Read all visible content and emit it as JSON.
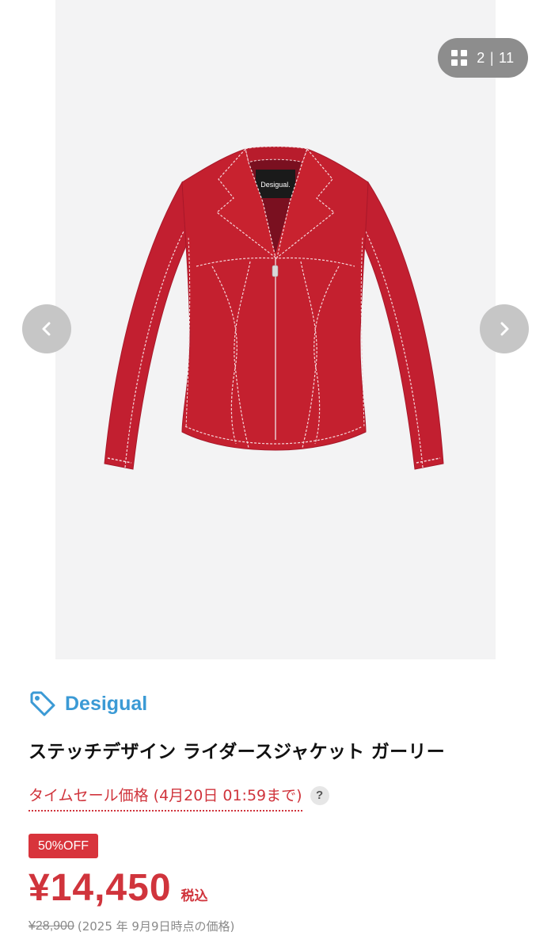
{
  "gallery": {
    "counter": {
      "current": "2",
      "separator": "|",
      "total": "11"
    },
    "jacket_label": "Desigual.",
    "prev_icon": "chevron-left-icon",
    "next_icon": "chevron-right-icon",
    "grid_icon": "grid-icon"
  },
  "product": {
    "brand": "Desigual",
    "brand_icon": "tag-icon",
    "title": "ステッチデザイン ライダースジャケット ガーリー",
    "sale_label": "タイムセール価格 (4月20日 01:59まで)",
    "help_icon": "?",
    "discount_badge": "50%OFF",
    "price": "¥14,450",
    "tax_label": "税込",
    "original_price": "¥28,900",
    "original_note": "(2025 年 9月9日時点の価格)"
  },
  "colors": {
    "brand_blue": "#3b9ad5",
    "sale_red": "#d0343c",
    "jacket_red": "#c4202f",
    "overlay_gray": "#8d8d8d"
  }
}
